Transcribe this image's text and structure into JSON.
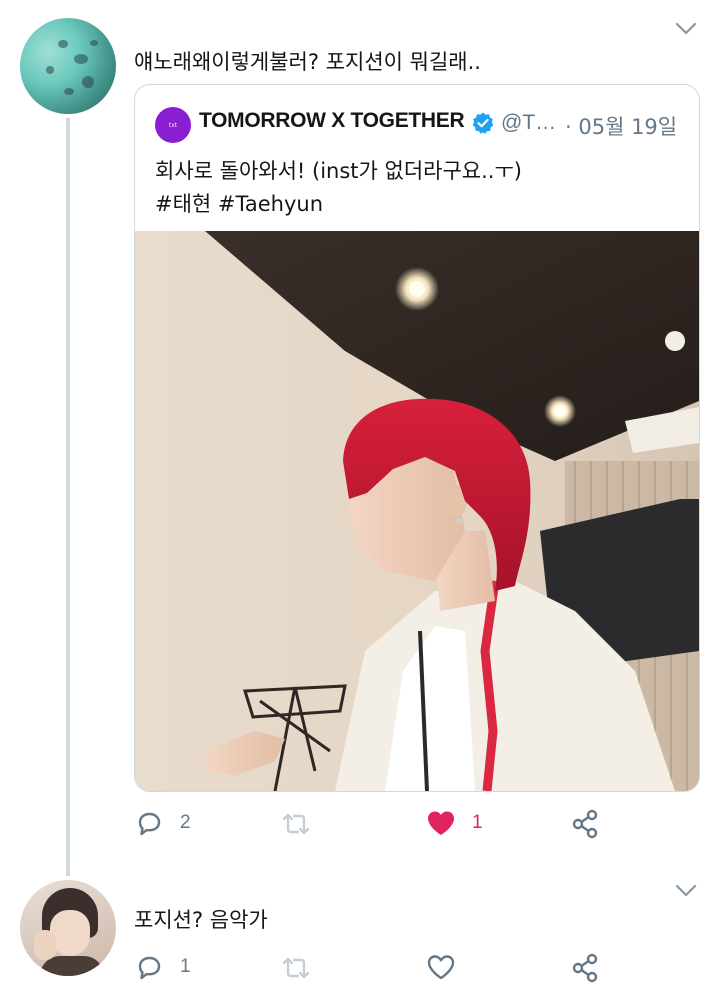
{
  "tweet1": {
    "text": "얘노래왜이렇게불러? 포지션이 뭐길래..",
    "quote": {
      "author_name": "TOMORROW X TOGETHER",
      "handle": "@T…",
      "date": "· 05월 19일",
      "avatar_text": "txt",
      "text_line1": "회사로 돌아와서! (inst가 없더라구요..ㅜ)",
      "text_line2": "#태현 #Taehyun"
    },
    "actions": {
      "reply_count": "2",
      "retweet_count": "",
      "like_count": "1",
      "liked": true
    }
  },
  "tweet2": {
    "text": "포지션? 음악가",
    "actions": {
      "reply_count": "1",
      "retweet_count": "",
      "like_count": ""
    }
  },
  "icons": {
    "reply": "comment-bubble-icon",
    "retweet": "retweet-icon",
    "like": "heart-icon",
    "share": "share-icon",
    "more": "chevron-down-icon",
    "verified": "verified-badge-icon"
  },
  "colors": {
    "text_primary": "#14171a",
    "text_secondary": "#657786",
    "like_active": "#e0245e",
    "verified_blue": "#1da1f2",
    "border": "#cfd9de"
  }
}
